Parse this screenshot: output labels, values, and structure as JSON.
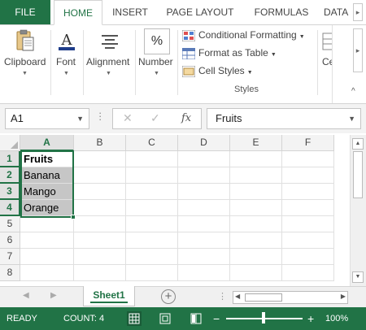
{
  "ribbon_tabs": [
    "FILE",
    "HOME",
    "INSERT",
    "PAGE LAYOUT",
    "FORMULAS",
    "DATA"
  ],
  "ribbon_groups": {
    "clipboard": "Clipboard",
    "font": "Font",
    "alignment": "Alignment",
    "number": "Number",
    "styles": "Styles",
    "cells_partial": "Ce"
  },
  "styles_items": [
    "Conditional Formatting",
    "Format as Table",
    "Cell Styles"
  ],
  "icons": {
    "percent_symbol": "%",
    "fx_symbol": "fx",
    "cancel_symbol": "✕",
    "enter_symbol": "✓"
  },
  "formula_bar": {
    "name_box": "A1",
    "formula": "Fruits"
  },
  "grid": {
    "columns": [
      "A",
      "B",
      "C",
      "D",
      "E",
      "F"
    ],
    "rows": [
      "1",
      "2",
      "3",
      "4",
      "5",
      "6",
      "7",
      "8"
    ],
    "cells": {
      "A1": "Fruits",
      "A2": "Banana",
      "A3": "Mango",
      "A4": "Orange"
    }
  },
  "sheet_tabs": [
    "Sheet1"
  ],
  "add_sheet_symbol": "+",
  "status_bar": {
    "ready": "READY",
    "count": "COUNT: 4",
    "zoom_minus": "−",
    "zoom_plus": "+",
    "zoom_percent": "100%",
    "zoom_level": 1.0
  },
  "colors": {
    "excel_green": "#217346",
    "header_bg": "#f3f3f3",
    "selection_bg": "#c6c6c6"
  }
}
